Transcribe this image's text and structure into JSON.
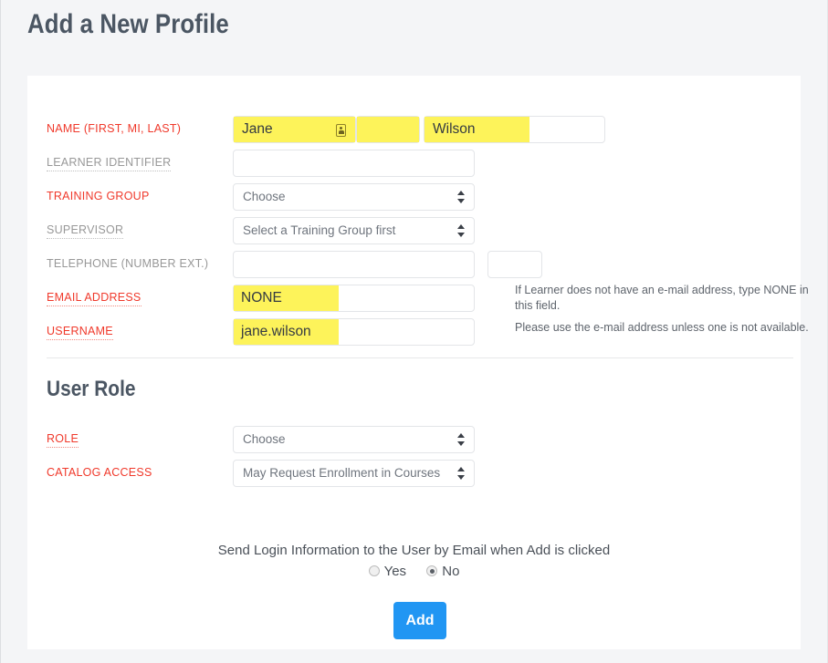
{
  "header": {
    "title": "Add a New Profile"
  },
  "form": {
    "name": {
      "label": "NAME (FIRST, MI, LAST)",
      "first_value": "Jane",
      "middle_value": "",
      "last_value": "Wilson",
      "autofill_icon": "contact-card-icon"
    },
    "learner_identifier": {
      "label": "LEARNER IDENTIFIER",
      "value": ""
    },
    "training_group": {
      "label": "TRAINING GROUP",
      "value": "Choose"
    },
    "supervisor": {
      "label": "SUPERVISOR",
      "value": "Select a Training Group first"
    },
    "telephone": {
      "label": "TELEPHONE (NUMBER EXT.)",
      "number_value": "",
      "ext_value": ""
    },
    "email": {
      "label": "EMAIL ADDRESS",
      "value": "NONE",
      "helper": "If Learner does not have an e-mail address, type NONE in this field."
    },
    "username": {
      "label": "USERNAME",
      "value": "jane.wilson",
      "helper": "Please use the e-mail address unless one is not available."
    }
  },
  "user_role": {
    "section_title": "User Role",
    "role": {
      "label": "ROLE",
      "value": "Choose"
    },
    "catalog_access": {
      "label": "CATALOG ACCESS",
      "value": "May Request Enrollment in Courses"
    }
  },
  "footer": {
    "send_login_text": "Send Login Information to the User by Email when Add is clicked",
    "radio_yes": "Yes",
    "radio_no": "No",
    "selected": "No",
    "add_label": "Add"
  },
  "colors": {
    "required_label": "#f0392b",
    "optional_label": "#989898",
    "highlight": "#fdf35a",
    "primary_button": "#2196f3",
    "page_background": "#f4f5f7",
    "card_background": "#ffffff",
    "heading": "#4b5663"
  }
}
